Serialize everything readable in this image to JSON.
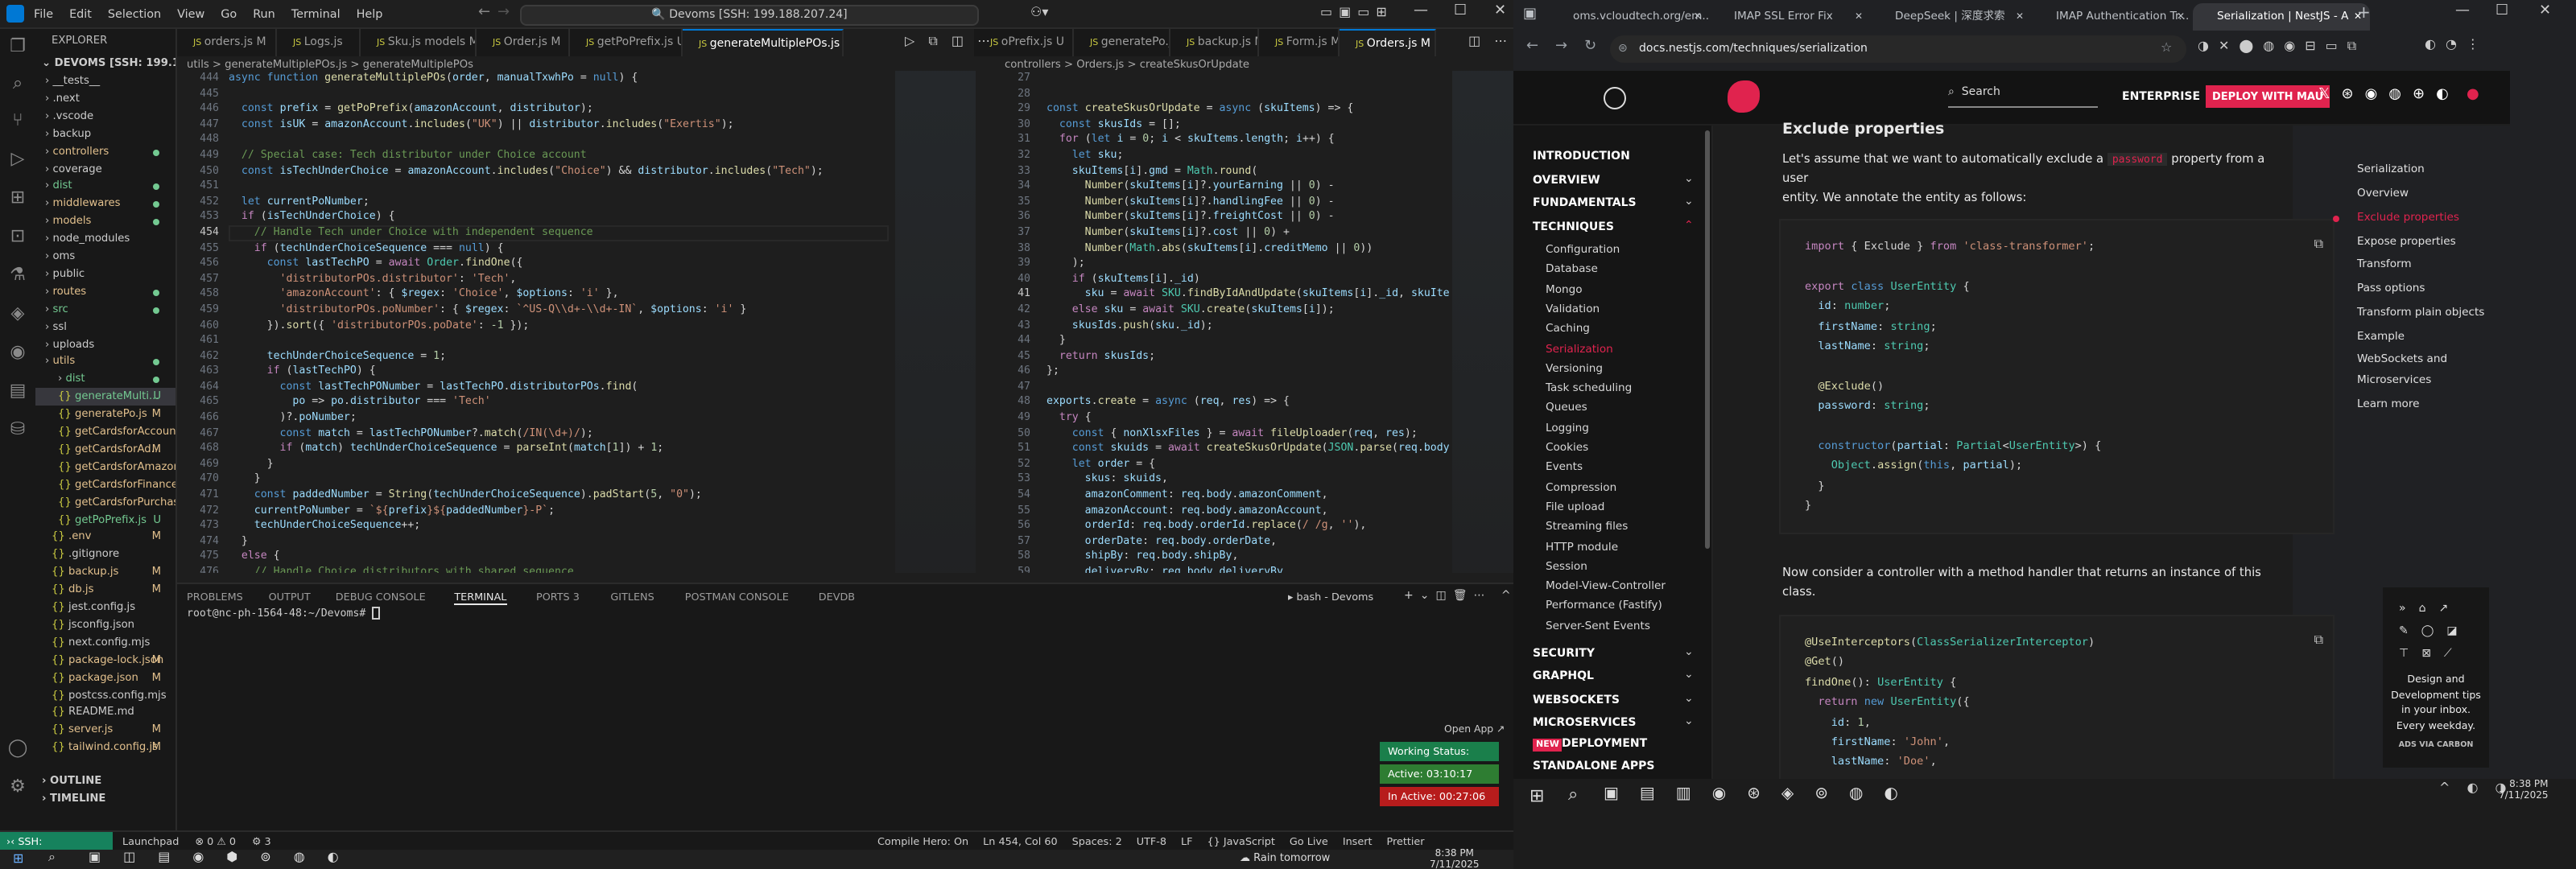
{
  "vscode": {
    "menu": [
      "File",
      "Edit",
      "Selection",
      "View",
      "Go",
      "Run",
      "Terminal",
      "Help"
    ],
    "command_center": "Devoms [SSH: 199.188.207.24]",
    "explorer": {
      "title": "EXPLORER",
      "root": "DEVOMS [SSH: 199.188.20...",
      "items": [
        {
          "label": "__tests__",
          "cls": ""
        },
        {
          "label": ".next",
          "cls": ""
        },
        {
          "label": ".vscode",
          "cls": ""
        },
        {
          "label": "backup",
          "cls": ""
        },
        {
          "label": "controllers",
          "cls": "yel",
          "dot": true
        },
        {
          "label": "coverage",
          "cls": ""
        },
        {
          "label": "dist",
          "cls": "grn",
          "dot": true
        },
        {
          "label": "middlewares",
          "cls": "yel",
          "dot": true
        },
        {
          "label": "models",
          "cls": "yel",
          "dot": true
        },
        {
          "label": "node_modules",
          "cls": ""
        },
        {
          "label": "oms",
          "cls": ""
        },
        {
          "label": "public",
          "cls": ""
        },
        {
          "label": "routes",
          "cls": "yel",
          "dot": true
        },
        {
          "label": "src",
          "cls": "grn",
          "dot": true
        },
        {
          "label": "ssl",
          "cls": ""
        },
        {
          "label": "uploads",
          "cls": ""
        },
        {
          "label": "utils",
          "cls": "yel",
          "dot": true
        },
        {
          "label": "dist",
          "cls": "grn",
          "dot": true
        },
        {
          "label": "generateMulti...",
          "cls": "grn sel",
          "m": "U"
        },
        {
          "label": "generatePo.js",
          "cls": "yel",
          "m": "M"
        },
        {
          "label": "getCardsforAccount.js",
          "cls": "yel",
          "m": ""
        },
        {
          "label": "getCardsforAd...",
          "cls": "yel",
          "m": "M"
        },
        {
          "label": "getCardsforAmazon.js",
          "cls": "yel",
          "m": ""
        },
        {
          "label": "getCardsforFinance.js",
          "cls": "yel",
          "m": ""
        },
        {
          "label": "getCardsforPurchasi...",
          "cls": "yel",
          "m": ""
        },
        {
          "label": "getPoPrefix.js",
          "cls": "grn",
          "m": "U"
        },
        {
          "label": ".env",
          "cls": "yel",
          "m": "M"
        },
        {
          "label": ".gitignore",
          "cls": ""
        },
        {
          "label": "backup.js",
          "cls": "yel",
          "m": "M"
        },
        {
          "label": "db.js",
          "cls": "yel",
          "m": "M"
        },
        {
          "label": "jest.config.js",
          "cls": ""
        },
        {
          "label": "jsconfig.json",
          "cls": ""
        },
        {
          "label": "next.config.mjs",
          "cls": ""
        },
        {
          "label": "package-lock.json",
          "cls": "yel",
          "m": "M"
        },
        {
          "label": "package.json",
          "cls": "yel",
          "m": "M"
        },
        {
          "label": "postcss.config.mjs",
          "cls": ""
        },
        {
          "label": "README.md",
          "cls": ""
        },
        {
          "label": "server.js",
          "cls": "yel",
          "m": "M"
        },
        {
          "label": "tailwind.config.js",
          "cls": "yel",
          "m": "M"
        }
      ],
      "outline": "OUTLINE",
      "timeline": "TIMELINE"
    },
    "tabs_left": [
      {
        "label": "orders.js M",
        "active": false
      },
      {
        "label": "Logs.js",
        "active": false
      },
      {
        "label": "Sku.js models M",
        "active": false
      },
      {
        "label": "Order.js M",
        "active": false
      },
      {
        "label": "getPoPrefix.js U",
        "active": false
      },
      {
        "label": "generateMultiplePOs.js U",
        "active": true
      }
    ],
    "tabs_right": [
      {
        "label": "oPrefix.js U",
        "active": false
      },
      {
        "label": "generatePo.js M",
        "active": false
      },
      {
        "label": "backup.js M",
        "active": false
      },
      {
        "label": "Form.js M",
        "active": false
      },
      {
        "label": "Orders.js M",
        "active": true
      }
    ],
    "breadcrumb_left": "utils > generateMultiplePOs.js > generateMultiplePOs",
    "breadcrumb_right": "controllers > Orders.js > createSkusOrUpdate",
    "left_start_line": 444,
    "left_code": [
      "<span class='kw'>async function</span> <span class='fn'>generateMultiplePOs</span>(<span class='vr'>order</span>, <span class='vr'>manualTxwhPo</span> = <span class='kw'>null</span>) {",
      "",
      "  <span class='kw'>const</span> <span class='vr'>prefix</span> = <span class='fn'>getPoPrefix</span>(<span class='vr'>amazonAccount</span>, <span class='vr'>distributor</span>);",
      "  <span class='kw'>const</span> <span class='vr'>isUK</span> = <span class='vr'>amazonAccount</span>.<span class='fn'>includes</span>(<span class='st'>\"UK\"</span>) || <span class='vr'>distributor</span>.<span class='fn'>includes</span>(<span class='st'>\"Exertis\"</span>);",
      "",
      "  <span class='cm'>// Special case: Tech distributor under Choice account</span>",
      "  <span class='kw'>const</span> <span class='vr'>isTechUnderChoice</span> = <span class='vr'>amazonAccount</span>.<span class='fn'>includes</span>(<span class='st'>\"Choice\"</span>) &amp;&amp; <span class='vr'>distributor</span>.<span class='fn'>includes</span>(<span class='st'>\"Tech\"</span>);",
      "",
      "  <span class='kw'>let</span> <span class='vr'>currentPoNumber</span>;",
      "  <span class='pk'>if</span> (<span class='vr'>isTechUnderChoice</span>) {",
      "    <span class='cm'>// Handle Tech under Choice with independent sequence</span>",
      "    <span class='pk'>if</span> (<span class='vr'>techUnderChoiceSequence</span> === <span class='kw'>null</span>) {",
      "      <span class='kw'>const</span> <span class='vr'>lastTechPO</span> = <span class='pk'>await</span> <span class='ty'>Order</span>.<span class='fn'>findOne</span>({",
      "        <span class='st'>'distributorPOs.distributor'</span>: <span class='st'>'Tech'</span>,",
      "        <span class='st'>'amazonAccount'</span>: { <span class='vr'>$regex</span>: <span class='st'>'Choice'</span>, <span class='vr'>$options</span>: <span class='st'>'i'</span> },",
      "        <span class='st'>'distributorPOs.poNumber'</span>: { <span class='vr'>$regex</span>: <span class='st'>`^US-Q\\\\d+-\\\\d+-IN`</span>, <span class='vr'>$options</span>: <span class='st'>'i'</span> }",
      "      }).<span class='fn'>sort</span>({ <span class='st'>'distributorPOs.poDate'</span>: <span class='nm'>-1</span> });",
      "",
      "      <span class='vr'>techUnderChoiceSequence</span> = <span class='nm'>1</span>;",
      "      <span class='pk'>if</span> (<span class='vr'>lastTechPO</span>) {",
      "        <span class='kw'>const</span> <span class='vr'>lastTechPONumber</span> = <span class='vr'>lastTechPO</span>.<span class='vr'>distributorPOs</span>.<span class='fn'>find</span>(",
      "          <span class='vr'>po</span> =&gt; <span class='vr'>po</span>.<span class='vr'>distributor</span> === <span class='st'>'Tech'</span>",
      "        )?.<span class='vr'>poNumber</span>;",
      "        <span class='kw'>const</span> <span class='vr'>match</span> = <span class='vr'>lastTechPONumber</span>?.<span class='fn'>match</span>(<span class='st'>/IN(\\d+)/</span>);",
      "        <span class='pk'>if</span> (<span class='vr'>match</span>) <span class='vr'>techUnderChoiceSequence</span> = <span class='fn'>parseInt</span>(<span class='vr'>match</span>[<span class='nm'>1</span>]) + <span class='nm'>1</span>;",
      "      }",
      "    }",
      "    <span class='kw'>const</span> <span class='vr'>paddedNumber</span> = <span class='fn'>String</span>(<span class='vr'>techUnderChoiceSequence</span>).<span class='fn'>padStart</span>(<span class='nm'>5</span>, <span class='st'>\"0\"</span>);",
      "    <span class='vr'>currentPoNumber</span> = <span class='st'>`${</span><span class='vr'>prefix</span><span class='st'>}${</span><span class='vr'>paddedNumber</span><span class='st'>}-P`</span>;",
      "    <span class='vr'>techUnderChoiceSequence</span>++;",
      "  }",
      "  <span class='pk'>else</span> {",
      "    <span class='cm'>// Handle Choice distributors with shared sequence</span>"
    ],
    "right_start_line": 27,
    "right_code": [
      "",
      "",
      "<span class='kw'>const</span> <span class='fn'>createSkusOrUpdate</span> = <span class='kw'>async</span> (<span class='vr'>skuItems</span>) =&gt; {",
      "  <span class='kw'>const</span> <span class='vr'>skusIds</span> = [];",
      "  <span class='pk'>for</span> (<span class='kw'>let</span> <span class='vr'>i</span> = <span class='nm'>0</span>; <span class='vr'>i</span> &lt; <span class='vr'>skuItems</span>.<span class='vr'>length</span>; <span class='vr'>i</span>++) {",
      "    <span class='kw'>let</span> <span class='vr'>sku</span>;",
      "    <span class='vr'>skuItems</span>[<span class='vr'>i</span>].<span class='vr'>gmd</span> = <span class='ty'>Math</span>.<span class='fn'>round</span>(",
      "      <span class='fn'>Number</span>(<span class='vr'>skuItems</span>[<span class='vr'>i</span>]?.<span class='vr'>yourEarning</span> || <span class='nm'>0</span>) -",
      "      <span class='fn'>Number</span>(<span class='vr'>skuItems</span>[<span class='vr'>i</span>]?.<span class='vr'>handlingFee</span> || <span class='nm'>0</span>) -",
      "      <span class='fn'>Number</span>(<span class='vr'>skuItems</span>[<span class='vr'>i</span>]?.<span class='vr'>freightCost</span> || <span class='nm'>0</span>) -",
      "      <span class='fn'>Number</span>(<span class='vr'>skuItems</span>[<span class='vr'>i</span>]?.<span class='vr'>cost</span> || <span class='nm'>0</span>) +",
      "      <span class='fn'>Number</span>(<span class='ty'>Math</span>.<span class='fn'>abs</span>(<span class='vr'>skuItems</span>[<span class='vr'>i</span>].<span class='vr'>creditMemo</span> || <span class='nm'>0</span>))",
      "    );",
      "    <span class='pk'>if</span> (<span class='vr'>skuItems</span>[<span class='vr'>i</span>].<span class='vr'>_id</span>)",
      "      <span class='vr'>sku</span> = <span class='pk'>await</span> <span class='ty'>SKU</span>.<span class='fn'>findByIdAndUpdate</span>(<span class='vr'>skuItems</span>[<span class='vr'>i</span>].<span class='vr'>_id</span>, <span class='vr'>skuItems</span>",
      "    <span class='pk'>else</span> <span class='vr'>sku</span> = <span class='pk'>await</span> <span class='ty'>SKU</span>.<span class='fn'>create</span>(<span class='vr'>skuItems</span>[<span class='vr'>i</span>]);",
      "    <span class='vr'>skusIds</span>.<span class='fn'>push</span>(<span class='vr'>sku</span>.<span class='vr'>_id</span>);",
      "  }",
      "  <span class='pk'>return</span> <span class='vr'>skusIds</span>;",
      "};",
      "",
      "<span class='vr'>exports</span>.<span class='fn'>create</span> = <span class='kw'>async</span> (<span class='vr'>req</span>, <span class='vr'>res</span>) =&gt; {",
      "  <span class='pk'>try</span> {",
      "    <span class='kw'>const</span> { <span class='vr'>nonXlsxFiles</span> } = <span class='pk'>await</span> <span class='fn'>fileUploader</span>(<span class='vr'>req</span>, <span class='vr'>res</span>);",
      "    <span class='kw'>const</span> <span class='vr'>skuids</span> = <span class='pk'>await</span> <span class='fn'>createSkusOrUpdate</span>(<span class='ty'>JSON</span>.<span class='fn'>parse</span>(<span class='vr'>req</span>.<span class='vr'>body</span>.",
      "    <span class='kw'>let</span> <span class='vr'>order</span> = {",
      "      <span class='vr'>skus</span>: <span class='vr'>skuids</span>,",
      "      <span class='vr'>amazonComment</span>: <span class='vr'>req</span>.<span class='vr'>body</span>.<span class='vr'>amazonComment</span>,",
      "      <span class='vr'>amazonAccount</span>: <span class='vr'>req</span>.<span class='vr'>body</span>.<span class='vr'>amazonAccount</span>,",
      "      <span class='vr'>orderId</span>: <span class='vr'>req</span>.<span class='vr'>body</span>.<span class='vr'>orderId</span>.<span class='fn'>replace</span>(<span class='st'>/ /g</span>, <span class='st'>''</span>),",
      "      <span class='vr'>orderDate</span>: <span class='vr'>req</span>.<span class='vr'>body</span>.<span class='vr'>orderDate</span>,",
      "      <span class='vr'>shipBy</span>: <span class='vr'>req</span>.<span class='vr'>body</span>.<span class='vr'>shipBy</span>,",
      "      <span class='vr'>deliveryBy</span>: <span class='vr'>req</span>.<span class='vr'>body</span>.<span class='vr'>deliveryBy</span>,"
    ],
    "panel_tabs": [
      "PROBLEMS",
      "OUTPUT",
      "DEBUG CONSOLE",
      "TERMINAL",
      "PORTS 3",
      "GITLENS",
      "POSTMAN CONSOLE",
      "DEVDB"
    ],
    "terminal_name": "bash - Devoms",
    "terminal_prompt": "root@nc-ph-1564-48:~/Devoms# ",
    "open_app": "Open App ↗",
    "working_status": "Working Status: Active",
    "active_time": "Active: 03:10:17",
    "inactive_time": "In Active: 00:27:06",
    "status_remote": "SSH: 199.188.207.24",
    "status_left": [
      "Launchpad",
      "⊗ 0 ⚠ 0",
      "⚙ 3"
    ],
    "status_right": [
      "Compile Hero: On",
      "Ln 454, Col 60",
      "Spaces: 2",
      "UTF-8",
      "LF",
      "{} JavaScript",
      "Go Live",
      "Insert",
      "Prettier"
    ],
    "weather": "Rain tomorrow",
    "time": "8:38 PM",
    "date": "7/11/2025"
  },
  "chrome": {
    "tabs": [
      {
        "label": "oms.vcloudtech.org/em...",
        "active": false
      },
      {
        "label": "IMAP SSL Error Fix",
        "active": false
      },
      {
        "label": "DeepSeek | 深度求索",
        "active": false
      },
      {
        "label": "IMAP Authentication Tr...",
        "active": false
      },
      {
        "label": "Serialization | NestJS - A",
        "active": true
      }
    ],
    "url": "docs.nestjs.com/techniques/serialization",
    "search_placeholder": "Search",
    "enterprise": "ENTERPRISE",
    "deploy": "DEPLOY WITH MAU",
    "nav_sections": [
      "INTRODUCTION",
      "OVERVIEW",
      "FUNDAMENTALS",
      "TECHNIQUES"
    ],
    "technique_items": [
      "Configuration",
      "Database",
      "Mongo",
      "Validation",
      "Caching",
      "Serialization",
      "Versioning",
      "Task scheduling",
      "Queues",
      "Logging",
      "Cookies",
      "Events",
      "Compression",
      "File upload",
      "Streaming files",
      "HTTP module",
      "Session",
      "Model-View-Controller",
      "Performance (Fastify)",
      "Server-Sent Events"
    ],
    "nav_bottom": [
      "SECURITY",
      "GRAPHQL",
      "WEBSOCKETS",
      "MICROSERVICES"
    ],
    "new_badge": "NEW",
    "deployment": "DEPLOYMENT",
    "standalone": "STANDALONE APPS",
    "heading": "Exclude properties",
    "para1a": "Let's assume that we want to automatically exclude a",
    "para1_code": "password",
    "para1b": "property from a user",
    "para1c": "entity. We annotate the entity as follows:",
    "code1": [
      "<span class='pk'>import</span> { Exclude } <span class='pk'>from</span> <span class='st'>'class-transformer'</span>;",
      "",
      "<span class='pk'>export</span> <span class='kw'>class</span> <span class='ty'>UserEntity</span> {",
      "  <span class='vr'>id</span>: <span class='ty'>number</span>;",
      "  <span class='vr'>firstName</span>: <span class='ty'>string</span>;",
      "  <span class='vr'>lastName</span>: <span class='ty'>string</span>;",
      "",
      "  <span class='fn'>@Exclude</span>()",
      "  <span class='vr'>password</span>: <span class='ty'>string</span>;",
      "",
      "  <span class='kw'>constructor</span>(<span class='vr'>partial</span>: <span class='ty'>Partial</span>&lt;<span class='ty'>UserEntity</span>&gt;) {",
      "    <span class='ty'>Object</span>.<span class='fn'>assign</span>(<span class='kw'>this</span>, <span class='vr'>partial</span>);",
      "  }",
      "}"
    ],
    "para2": "Now consider a controller with a method handler that returns an instance of this class.",
    "code2": [
      "<span class='fn'>@UseInterceptors</span>(<span class='ty'>ClassSerializerInterceptor</span>)",
      "<span class='fn'>@Get</span>()",
      "<span class='fn'>findOne</span>(): <span class='ty'>UserEntity</span> {",
      "  <span class='pk'>return</span> <span class='kw'>new</span> <span class='ty'>UserEntity</span>({",
      "    <span class='vr'>id</span>: <span class='nm'>1</span>,",
      "    <span class='vr'>firstName</span>: <span class='st'>'John'</span>,",
      "    <span class='vr'>lastName</span>: <span class='st'>'Doe'</span>,"
    ],
    "toc": [
      "Serialization",
      "Overview",
      "Exclude properties",
      "Expose properties",
      "Transform",
      "Pass options",
      "Transform plain objects",
      "Example",
      "WebSockets and",
      "Microservices",
      "Learn more"
    ],
    "ad_text": "Design and Development tips in your inbox. Every weekday.",
    "ad_via": "ADS VIA CARBON",
    "time": "8:38 PM",
    "date": "7/11/2025"
  }
}
